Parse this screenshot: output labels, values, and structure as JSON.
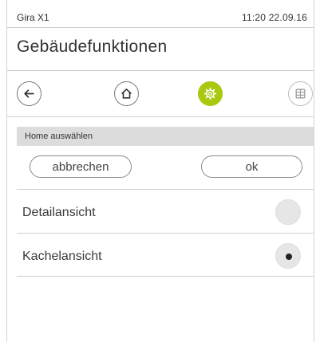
{
  "statusbar": {
    "brand": "Gira X1",
    "time": "11:20  22.09.16"
  },
  "page": {
    "title": "Gebäudefunktionen"
  },
  "nav": {
    "icons": [
      "back-arrow-icon",
      "home-icon",
      "settings-gear-icon",
      "grid-tiles-icon"
    ],
    "active_color": "#a8c910"
  },
  "section": {
    "title": "Home auswählen"
  },
  "actions": {
    "cancel_label": "abbrechen",
    "ok_label": "ok"
  },
  "options": [
    {
      "label": "Detailansicht",
      "selected": false
    },
    {
      "label": "Kachelansicht",
      "selected": true
    }
  ]
}
